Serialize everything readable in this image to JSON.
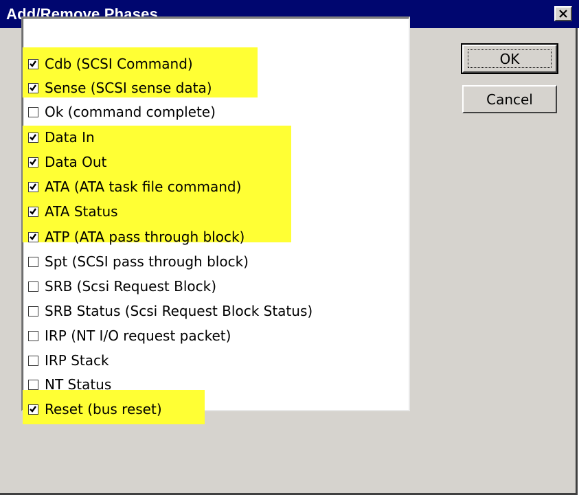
{
  "window": {
    "title": "Add/Remove Phases"
  },
  "buttons": {
    "ok": "OK",
    "cancel": "Cancel"
  },
  "highlight_color": "#ffff34",
  "titlebar_color": "#00066f",
  "phases": [
    {
      "label": "Cdb (SCSI Command)",
      "checked": true,
      "highlighted": true
    },
    {
      "label": "Sense (SCSI sense data)",
      "checked": true,
      "highlighted": true
    },
    {
      "label": "Ok (command complete)",
      "checked": false,
      "highlighted": false
    },
    {
      "label": "Data In",
      "checked": true,
      "highlighted": true
    },
    {
      "label": "Data Out",
      "checked": true,
      "highlighted": true
    },
    {
      "label": "ATA (ATA task file command)",
      "checked": true,
      "highlighted": true
    },
    {
      "label": "ATA Status",
      "checked": true,
      "highlighted": true
    },
    {
      "label": "ATP (ATA pass through block)",
      "checked": true,
      "highlighted": true
    },
    {
      "label": "Spt (SCSI pass through block)",
      "checked": false,
      "highlighted": false
    },
    {
      "label": "SRB (Scsi Request Block)",
      "checked": false,
      "highlighted": false
    },
    {
      "label": "SRB Status (Scsi Request Block Status)",
      "checked": false,
      "highlighted": false
    },
    {
      "label": "IRP (NT I/O request packet)",
      "checked": false,
      "highlighted": false
    },
    {
      "label": "IRP Stack",
      "checked": false,
      "highlighted": false
    },
    {
      "label": "NT Status",
      "checked": false,
      "highlighted": false
    },
    {
      "label": "Reset (bus reset)",
      "checked": true,
      "highlighted": true
    }
  ]
}
